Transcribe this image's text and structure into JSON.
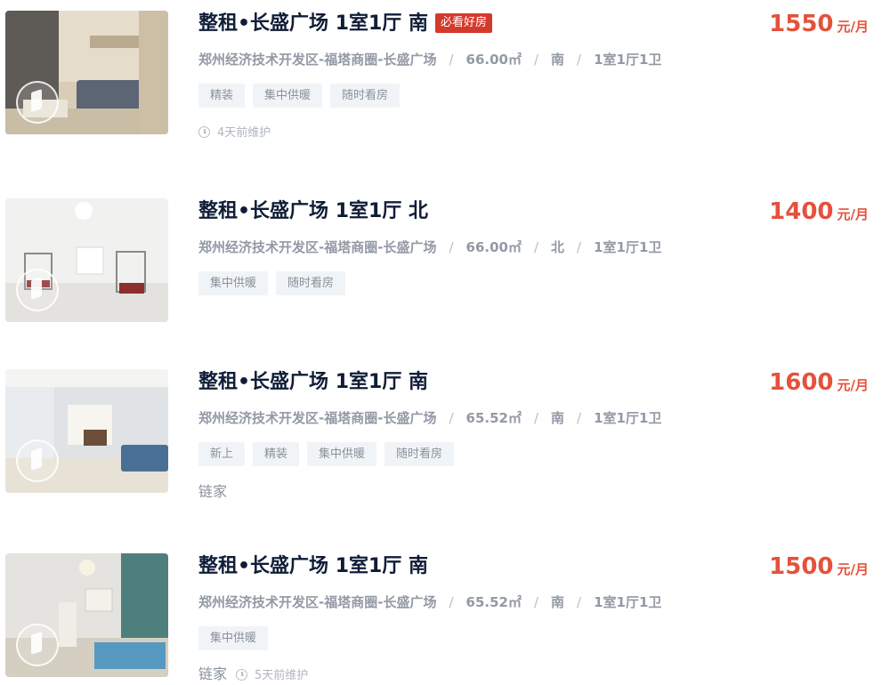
{
  "listings": [
    {
      "title": "整租•长盛广场 1室1厅 南",
      "badge": "必看好房",
      "location": "郑州经济技术开发区-福塔商圈-长盛广场",
      "area": "66.00㎡",
      "orientation": "南",
      "layout": "1室1厅1卫",
      "tags": [
        "精装",
        "集中供暖",
        "随时看房"
      ],
      "brand": "",
      "maintained": "4天前维护",
      "price": "1550",
      "price_unit": "元/月"
    },
    {
      "title": "整租•长盛广场 1室1厅 北",
      "location": "郑州经济技术开发区-福塔商圈-长盛广场",
      "area": "66.00㎡",
      "orientation": "北",
      "layout": "1室1厅1卫",
      "tags": [
        "集中供暖",
        "随时看房"
      ],
      "price": "1400",
      "price_unit": "元/月"
    },
    {
      "title": "整租•长盛广场 1室1厅 南",
      "location": "郑州经济技术开发区-福塔商圈-长盛广场",
      "area": "65.52㎡",
      "orientation": "南",
      "layout": "1室1厅1卫",
      "tags": [
        "新上",
        "精装",
        "集中供暖",
        "随时看房"
      ],
      "brand": "链家",
      "price": "1600",
      "price_unit": "元/月"
    },
    {
      "title": "整租•长盛广场 1室1厅 南",
      "location": "郑州经济技术开发区-福塔商圈-长盛广场",
      "area": "65.52㎡",
      "orientation": "南",
      "layout": "1室1厅1卫",
      "tags": [
        "集中供暖"
      ],
      "brand": "链家",
      "maintained": "5天前维护",
      "price": "1500",
      "price_unit": "元/月"
    }
  ],
  "separator": "/",
  "icons": {
    "vr": "vr-panorama-icon",
    "clock": "clock-icon"
  },
  "colors": {
    "price": "#e5513b",
    "badge": "#d43a2c",
    "title": "#101d37",
    "tag_bg": "#f1f4f7"
  }
}
